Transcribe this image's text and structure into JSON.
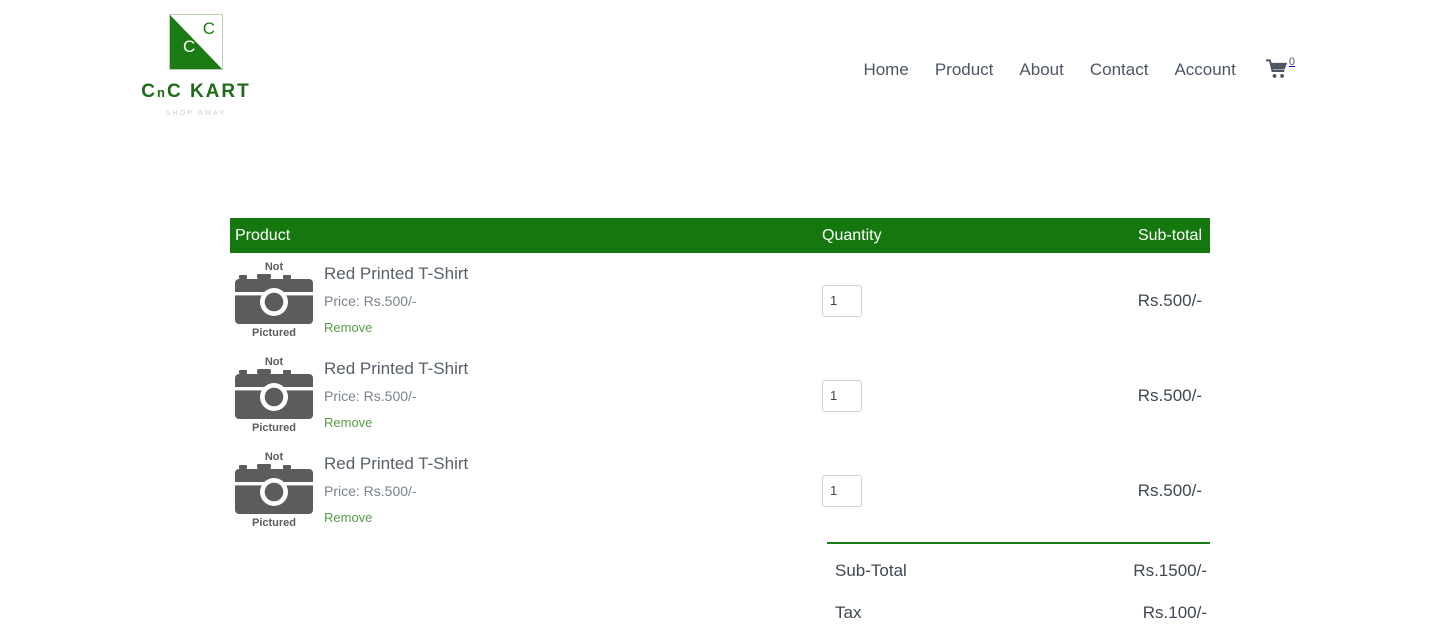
{
  "brand": {
    "mark_letter_top": "C",
    "mark_letter_bottom": "C",
    "name_part1": "C",
    "name_part_small": "n",
    "name_part2": "C KART",
    "tagline": "SHOP AWAY"
  },
  "nav": {
    "items": [
      {
        "label": "Home"
      },
      {
        "label": "Product"
      },
      {
        "label": "About"
      },
      {
        "label": "Contact"
      },
      {
        "label": "Account"
      }
    ],
    "cart_icon": "shopping-cart-icon",
    "cart_count": "0"
  },
  "cart": {
    "columns": {
      "product": "Product",
      "quantity": "Quantity",
      "subtotal": "Sub-total"
    },
    "placeholder_image": {
      "top_text": "Not",
      "bottom_text": "Pictured"
    },
    "remove_label": "Remove",
    "rows": [
      {
        "title": "Red Printed T-Shirt",
        "price": "Price: Rs.500/-",
        "quantity": "1",
        "subtotal": "Rs.500/-"
      },
      {
        "title": "Red Printed T-Shirt",
        "price": "Price: Rs.500/-",
        "quantity": "1",
        "subtotal": "Rs.500/-"
      },
      {
        "title": "Red Printed T-Shirt",
        "price": "Price: Rs.500/-",
        "quantity": "1",
        "subtotal": "Rs.500/-"
      }
    ],
    "totals": [
      {
        "label": "Sub-Total",
        "value": "Rs.1500/-"
      },
      {
        "label": "Tax",
        "value": "Rs.100/-"
      }
    ]
  },
  "colors": {
    "brand_green": "#15780e",
    "link_green": "#579b46",
    "nav_text": "#4d5663"
  }
}
